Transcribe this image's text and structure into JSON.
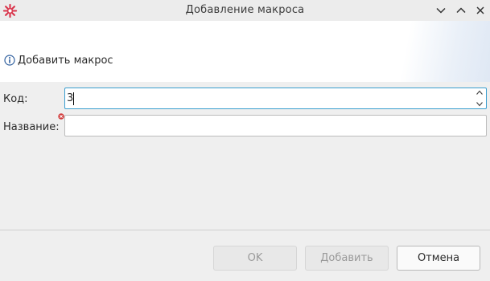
{
  "window": {
    "title": "Добавление макроса",
    "controls": [
      "chevron-down-icon",
      "chevron-up-icon",
      "close-icon"
    ]
  },
  "banner": {
    "icon": "info-icon",
    "message": "Добавить макрос"
  },
  "form": {
    "code": {
      "label": "Код:",
      "value": "3"
    },
    "name": {
      "label": "Название:",
      "value": "",
      "required_marker": "error-icon"
    }
  },
  "buttons": {
    "ok": "OK",
    "add": "Добавить",
    "cancel": "Отмена"
  },
  "colors": {
    "focus_border": "#3a9ecf",
    "logo": "#d9334a",
    "info": "#2f5f9e",
    "error": "#d23c3c"
  }
}
